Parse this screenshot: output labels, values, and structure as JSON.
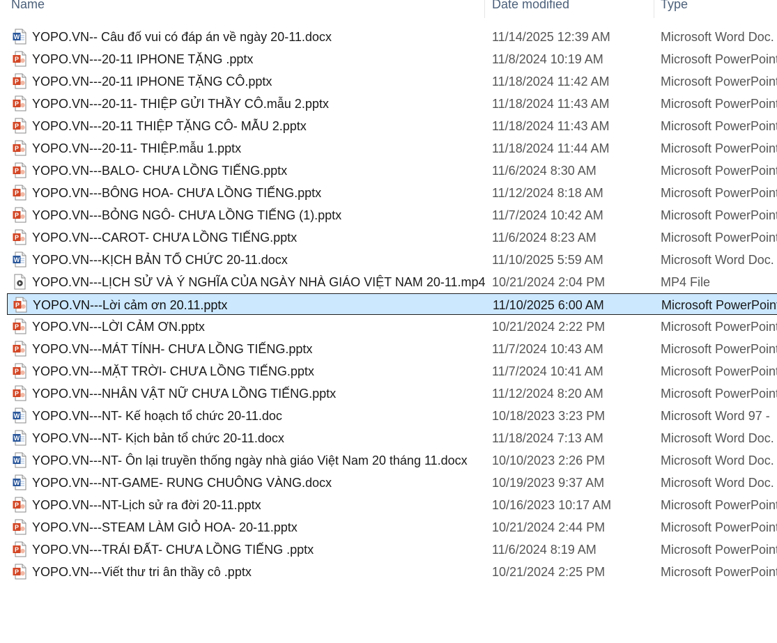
{
  "columns": {
    "name": "Name",
    "date": "Date modified",
    "type": "Type"
  },
  "icon_colors": {
    "word": "#2b579a",
    "powerpoint": "#d24726",
    "video": "#444444"
  },
  "selection_color": "#cce8ff",
  "files": [
    {
      "name": "YOPO.VN-- Câu đố vui có đáp án về ngày 20-11.docx",
      "date": "11/14/2025 12:39 AM",
      "type": "Microsoft Word Doc.",
      "icon": "word-doc-icon"
    },
    {
      "name": "YOPO.VN---20-11 IPHONE TẶNG .pptx",
      "date": "11/8/2024 10:19 AM",
      "type": "Microsoft PowerPoint",
      "icon": "powerpoint-icon"
    },
    {
      "name": "YOPO.VN---20-11 IPHONE TẶNG CÔ.pptx",
      "date": "11/18/2024 11:42 AM",
      "type": "Microsoft PowerPoint",
      "icon": "powerpoint-icon"
    },
    {
      "name": "YOPO.VN---20-11- THIỆP GỬI THẦY CÔ.mẫu 2.pptx",
      "date": "11/18/2024 11:43 AM",
      "type": "Microsoft PowerPoint",
      "icon": "powerpoint-icon"
    },
    {
      "name": "YOPO.VN---20-11 THIỆP TẶNG CÔ- MẪU 2.pptx",
      "date": "11/18/2024 11:43 AM",
      "type": "Microsoft PowerPoint",
      "icon": "powerpoint-icon"
    },
    {
      "name": "YOPO.VN---20-11- THIỆP.mẫu 1.pptx",
      "date": "11/18/2024 11:44 AM",
      "type": "Microsoft PowerPoint",
      "icon": "powerpoint-icon"
    },
    {
      "name": "YOPO.VN---BALO- CHƯA LỒNG TIẾNG.pptx",
      "date": "11/6/2024 8:30 AM",
      "type": "Microsoft PowerPoint",
      "icon": "powerpoint-icon"
    },
    {
      "name": "YOPO.VN---BÔNG HOA- CHƯA LỒNG TIẾNG.pptx",
      "date": "11/12/2024 8:18 AM",
      "type": "Microsoft PowerPoint",
      "icon": "powerpoint-icon"
    },
    {
      "name": "YOPO.VN---BỎNG NGÔ- CHƯA LỒNG TIẾNG (1).pptx",
      "date": "11/7/2024 10:42 AM",
      "type": "Microsoft PowerPoint",
      "icon": "powerpoint-icon"
    },
    {
      "name": "YOPO.VN---CAROT- CHƯA LỒNG TIẾNG.pptx",
      "date": "11/6/2024 8:23 AM",
      "type": "Microsoft PowerPoint",
      "icon": "powerpoint-icon"
    },
    {
      "name": "YOPO.VN---KỊCH BẢN TỔ CHỨC 20-11.docx",
      "date": "11/10/2025 5:59 AM",
      "type": "Microsoft Word Doc.",
      "icon": "word-doc-icon"
    },
    {
      "name": "YOPO.VN---LỊCH SỬ VÀ Ý NGHĨA CỦA NGÀY NHÀ GIÁO VIỆT NAM 20-11.mp4",
      "date": "10/21/2024 2:04 PM",
      "type": "MP4 File",
      "icon": "video-file-icon"
    },
    {
      "name": "YOPO.VN---Lời cảm ơn 20.11.pptx",
      "date": "11/10/2025 6:00 AM",
      "type": "Microsoft PowerPoint",
      "icon": "powerpoint-icon",
      "selected": true
    },
    {
      "name": "YOPO.VN---LỜI CẢM ƠN.pptx",
      "date": "10/21/2024 2:22 PM",
      "type": "Microsoft PowerPoint",
      "icon": "powerpoint-icon"
    },
    {
      "name": "YOPO.VN---MÁT TÍNH- CHƯA LỒNG TIẾNG.pptx",
      "date": "11/7/2024 10:43 AM",
      "type": "Microsoft PowerPoint",
      "icon": "powerpoint-icon"
    },
    {
      "name": "YOPO.VN---MẶT TRỜI- CHƯA LỒNG TIẾNG.pptx",
      "date": "11/7/2024 10:41 AM",
      "type": "Microsoft PowerPoint",
      "icon": "powerpoint-icon"
    },
    {
      "name": "YOPO.VN---NHÂN VẬT NỮ CHƯA LỒNG TIẾNG.pptx",
      "date": "11/12/2024 8:20 AM",
      "type": "Microsoft PowerPoint",
      "icon": "powerpoint-icon"
    },
    {
      "name": "YOPO.VN---NT- Kế hoạch tổ chức 20-11.doc",
      "date": "10/18/2023 3:23 PM",
      "type": "Microsoft Word 97 -",
      "icon": "word-doc-icon"
    },
    {
      "name": "YOPO.VN---NT- Kịch bản tổ chức 20-11.docx",
      "date": "11/18/2024 7:13 AM",
      "type": "Microsoft Word Doc.",
      "icon": "word-doc-icon"
    },
    {
      "name": "YOPO.VN---NT- Ôn lại truyền thống ngày nhà giáo Việt Nam 20 tháng 11.docx",
      "date": "10/10/2023 2:26 PM",
      "type": "Microsoft Word Doc.",
      "icon": "word-doc-icon"
    },
    {
      "name": "YOPO.VN---NT-GAME- RUNG CHUÔNG VÀNG.docx",
      "date": "10/19/2023 9:37 AM",
      "type": "Microsoft Word Doc.",
      "icon": "word-doc-icon"
    },
    {
      "name": "YOPO.VN---NT-Lịch sử ra đời 20-11.pptx",
      "date": "10/16/2023 10:17 AM",
      "type": "Microsoft PowerPoint",
      "icon": "powerpoint-icon"
    },
    {
      "name": "YOPO.VN---STEAM LÀM GIỎ HOA- 20-11.pptx",
      "date": "10/21/2024 2:44 PM",
      "type": "Microsoft PowerPoint",
      "icon": "powerpoint-icon"
    },
    {
      "name": "YOPO.VN---TRÁI ĐẤT- CHƯA LỒNG TIẾNG .pptx",
      "date": "11/6/2024 8:19 AM",
      "type": "Microsoft PowerPoint",
      "icon": "powerpoint-icon"
    },
    {
      "name": "YOPO.VN---Viết thư tri ân thầy cô .pptx",
      "date": "10/21/2024 2:25 PM",
      "type": "Microsoft PowerPoint",
      "icon": "powerpoint-icon"
    }
  ]
}
